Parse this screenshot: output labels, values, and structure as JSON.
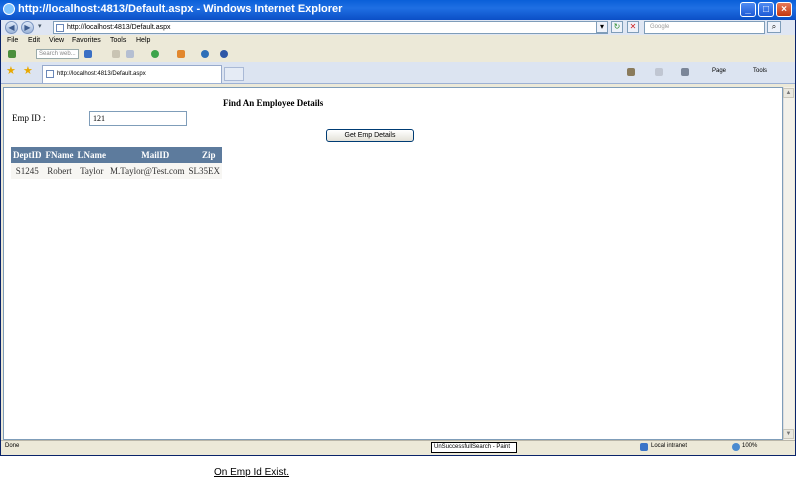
{
  "browser": {
    "window_title": "http://localhost:4813/Default.aspx - Windows Internet Explorer",
    "address": "http://localhost:4813/Default.aspx",
    "search_placeholder": "Google",
    "menu": [
      "File",
      "Edit",
      "View",
      "Favorites",
      "Tools",
      "Help"
    ],
    "toolbar_search_placeholder": "Search web...",
    "tab_title": "http://localhost:4813/Default.aspx",
    "command_bar": {
      "page_label": "Page",
      "tools_label": "Tools"
    },
    "status": {
      "text": "Done",
      "taskbar_item": "UnSuccessfullSearch - Paint",
      "zone": "Local intranet",
      "zoom": "100%"
    }
  },
  "page": {
    "title": "Find An Employee Details",
    "emp_id_label": "Emp ID :",
    "emp_id_value": "121",
    "button_label": "Get Emp Details",
    "grid": {
      "headers": [
        "DeptID",
        "FName",
        "LName",
        "MailID",
        "Zip"
      ],
      "rows": [
        [
          "S1245",
          "Robert",
          "Taylor",
          "M.Taylor@Test.com",
          "SL35EX"
        ]
      ]
    }
  },
  "caption": "On Emp Id Exist.",
  "colors": {
    "grid_header_bg": "#5d7b9d",
    "grid_header_text": "#ffffff",
    "grid_row_bg": "#f7f6f3",
    "titlebar": "#0a5fd8"
  }
}
